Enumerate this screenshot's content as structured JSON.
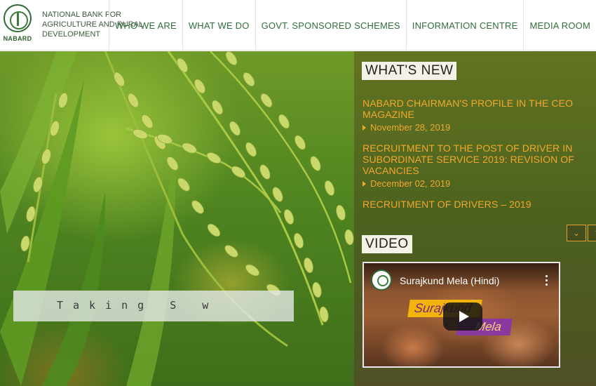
{
  "header": {
    "logo_text": "NABARD",
    "brand_name": "NATIONAL BANK FOR AGRICULTURE AND RURAL DEVELOPMENT",
    "nav": [
      "WHO WE ARE",
      "WHAT WE DO",
      "GOVT. SPONSORED SCHEMES",
      "INFORMATION CENTRE",
      "MEDIA ROOM"
    ]
  },
  "hero": {
    "caption": "Taking  S w"
  },
  "whats_new": {
    "title": "WHAT'S NEW",
    "items": [
      {
        "headline": "NABARD CHAIRMAN'S PROFILE IN THE CEO MAGAZINE",
        "date": "November 28, 2019"
      },
      {
        "headline": "RECRUITMENT TO THE POST OF DRIVER IN SUBORDINATE SERVICE 2019: REVISION OF VACANCIES",
        "date": "December 02, 2019"
      },
      {
        "headline": "RECRUITMENT OF DRIVERS – 2019",
        "date": ""
      }
    ],
    "scroll_down": "⌄",
    "scroll_up": "⌃"
  },
  "video": {
    "title": "VIDEO",
    "name": "Surajkund Mela (Hindi)",
    "tag_line1": "Surajkund",
    "tag_line2": "Mela"
  },
  "colors": {
    "accent": "#f0a830",
    "brand_green": "#2f6e3a"
  }
}
